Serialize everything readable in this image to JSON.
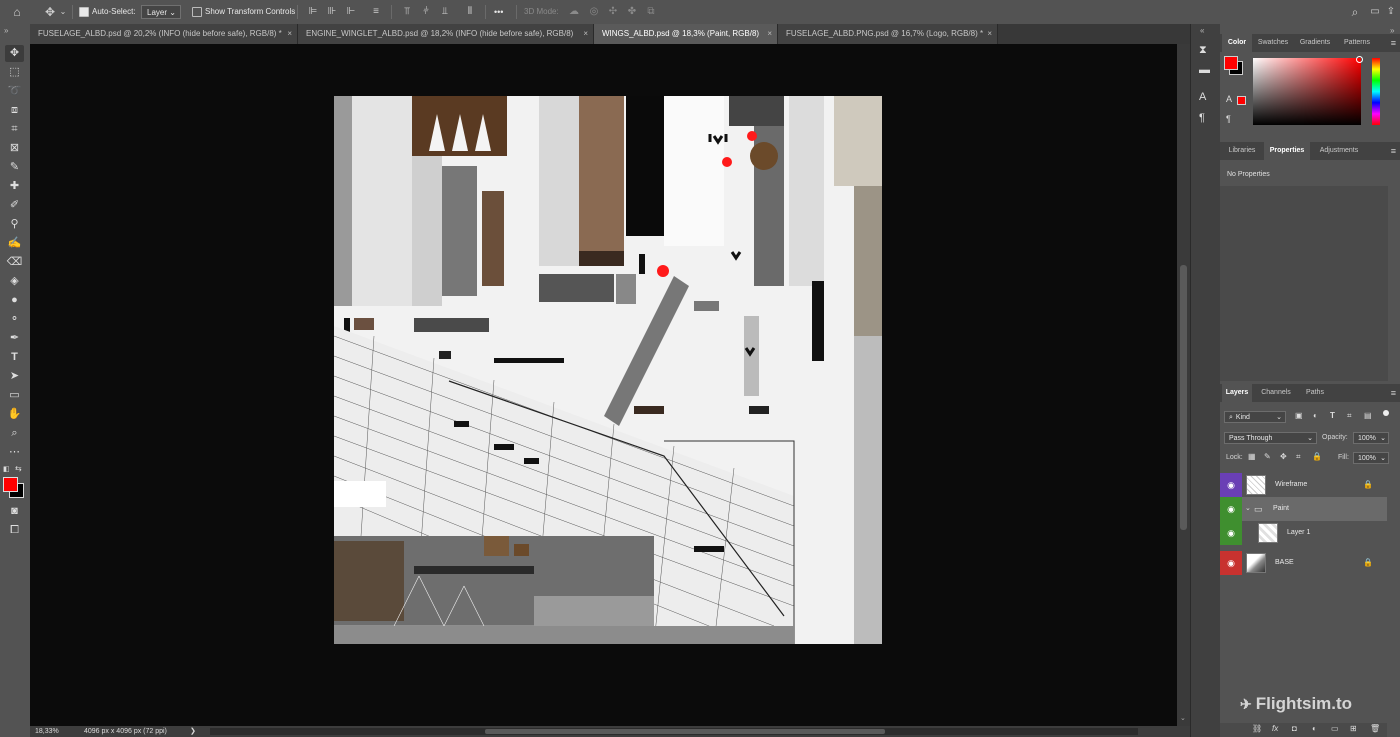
{
  "options_bar": {
    "auto_select_label": "Auto-Select:",
    "auto_select_value": "Layer",
    "show_transform_label": "Show Transform Controls",
    "mode_3d_label": "3D Mode:",
    "more_glyph": "•••"
  },
  "tabs": [
    {
      "label": "FUSELAGE_ALBD.psd @ 20,2% (INFO (hide before safe), RGB/8) *",
      "close": "×"
    },
    {
      "label": "ENGINE_WINGLET_ALBD.psd @ 18,2% (INFO (hide before safe), RGB/8)",
      "close": "×"
    },
    {
      "label": "WINGS_ALBD.psd @ 18,3% (Paint, RGB/8)",
      "close": "×"
    },
    {
      "label": "FUSELAGE_ALBD.PNG.psd @ 16,7% (Logo, RGB/8) *",
      "close": "×"
    }
  ],
  "status": {
    "zoom": "18,33%",
    "doc_info": "4096 px x 4096 px (72 ppi)",
    "arrow": "❯"
  },
  "color_panel": {
    "tabs": [
      "Color",
      "Swatches",
      "Gradients",
      "Patterns"
    ],
    "foreground": "#ff0000",
    "background": "#000000"
  },
  "properties_panel": {
    "tabs": [
      "Libraries",
      "Properties",
      "Adjustments"
    ],
    "empty_text": "No Properties"
  },
  "layers_panel": {
    "tabs": [
      "Layers",
      "Channels",
      "Paths"
    ],
    "filter_kind": "Kind",
    "blend_mode": "Pass Through",
    "opacity_label": "Opacity:",
    "opacity_value": "100%",
    "lock_label": "Lock:",
    "fill_label": "Fill:",
    "fill_value": "100%",
    "layers": [
      {
        "name": "Wireframe",
        "color": "#6a3fb5"
      },
      {
        "name": "Paint",
        "color": "#3f8f2f"
      },
      {
        "name": "Layer 1",
        "color": "#3f8f2f"
      },
      {
        "name": "BASE",
        "color": "#c8322f"
      }
    ]
  },
  "watermark": "Flightsim.to"
}
